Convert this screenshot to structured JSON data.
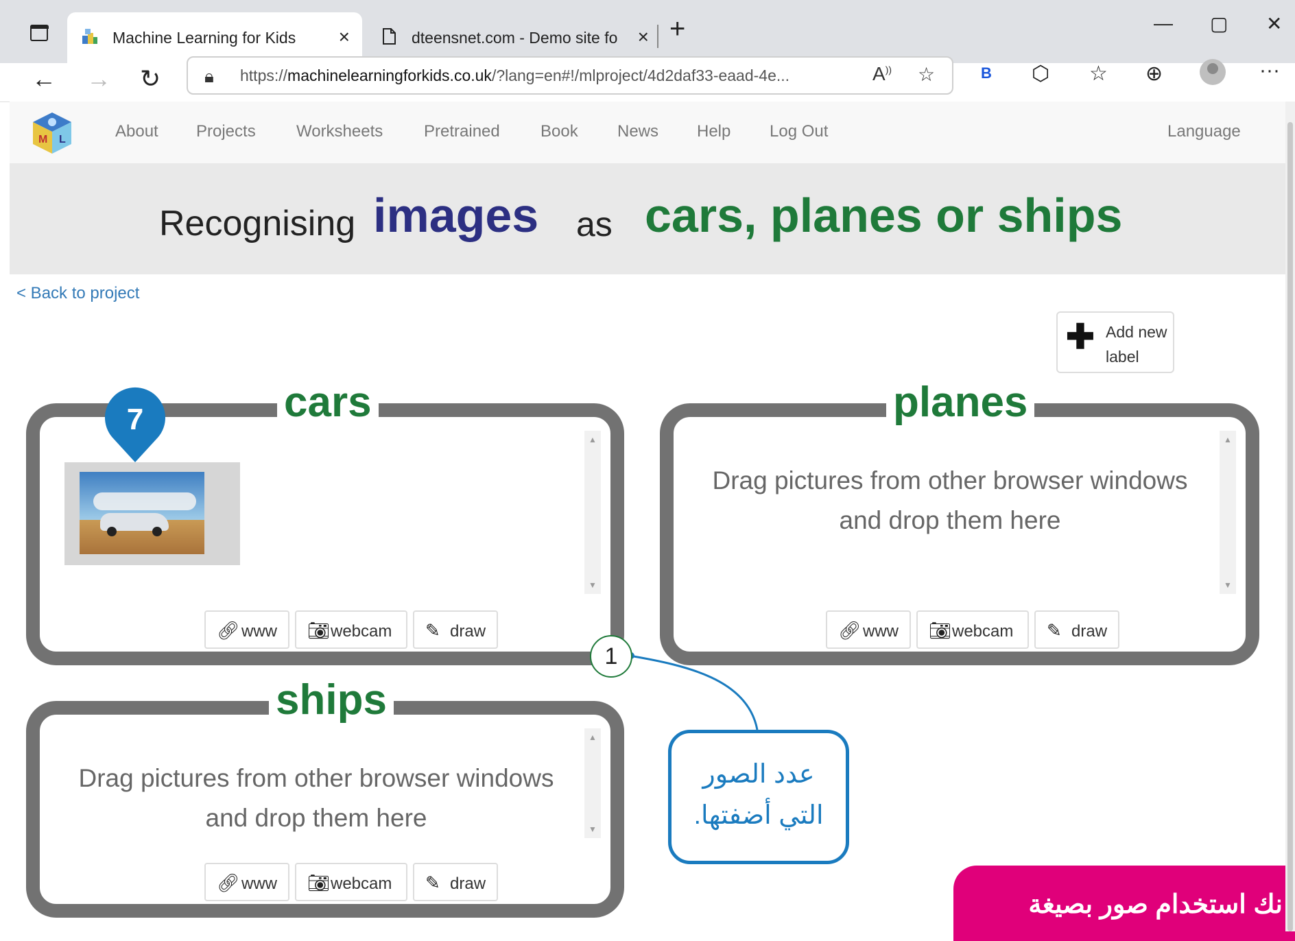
{
  "browser": {
    "tabs": [
      {
        "title": "Machine Learning for Kids",
        "active": true
      },
      {
        "title": "dteensnet.com - Demo site for D",
        "active": false
      }
    ],
    "new_tab_symbol": "+",
    "close_symbol": "×",
    "window_controls": {
      "minimize": "—",
      "maximize": "▢",
      "close": "✕"
    },
    "nav": {
      "back": "←",
      "forward": "→",
      "reload": "↻"
    },
    "address": {
      "prefix": "https://",
      "host": "machinelearningforkids.co.uk",
      "path": "/?lang=en#!/mlproject/4d2daf33-eaad-4e..."
    },
    "toolbar_icons": [
      "read-aloud-icon",
      "favorite-add-icon",
      "bing-icon",
      "extensions-icon",
      "favorites-icon",
      "collections-icon",
      "profile-icon",
      "more-icon"
    ],
    "bing_letter": "B",
    "more_symbol": "···"
  },
  "site": {
    "nav_links": [
      "About",
      "Projects",
      "Worksheets",
      "Pretrained",
      "Book",
      "News",
      "Help",
      "Log Out"
    ],
    "language_label": "Language",
    "heading": {
      "part1": "Recognising",
      "part2": "images",
      "part3": "as",
      "part4": "cars, planes or ships"
    },
    "back_link": "< Back to project",
    "add_label_button": {
      "line1": "Add new",
      "line2": "label"
    },
    "buckets": [
      {
        "name": "cars",
        "drop_text": "",
        "image_count": 1
      },
      {
        "name": "planes",
        "drop_text": "Drag pictures from other browser windows and drop them here",
        "drop_line1": "Drag pictures from other browser windows",
        "drop_line2": "and drop them here"
      },
      {
        "name": "ships",
        "drop_text": "Drag pictures from other browser windows and drop them here",
        "drop_line1": "Drag pictures from other browser windows",
        "drop_line2": "and drop them here"
      }
    ],
    "bucket_buttons": {
      "www": "www",
      "webcam": "webcam",
      "draw": "draw"
    }
  },
  "annotations": {
    "pin_number": "7",
    "callout_number": "1",
    "callout_line1": "عدد الصور",
    "callout_line2": "التي أضفتها.",
    "banner_text": "نك استخدام صور بصيغة",
    "colors": {
      "pin": "#1a7bbf",
      "callout_border": "#1a7bbf",
      "banner": "#e0007a",
      "label_green": "#1f7a3a",
      "images_navy": "#2c2f82"
    }
  }
}
